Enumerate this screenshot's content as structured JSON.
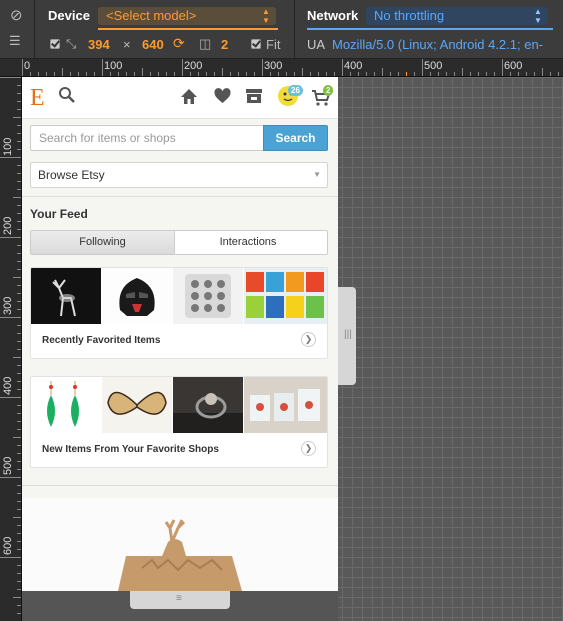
{
  "toolbar": {
    "device_label": "Device",
    "model_value": "<Select model>",
    "network_label": "Network",
    "network_value": "No throttling",
    "width_value": "394",
    "times": "×",
    "height_value": "640",
    "dpr_value": "2",
    "fit_label": "Fit",
    "ua_label": "UA",
    "ua_value": "Mozilla/5.0 (Linux; Android 4.2.1; en-",
    "accent_orange": "#ff9a2e",
    "accent_blue": "#58a8ff"
  },
  "ruler": {
    "top_labels": [
      "0",
      "100",
      "200",
      "300",
      "400",
      "500",
      "600"
    ],
    "left_labels": [
      "100",
      "200",
      "300",
      "400",
      "500",
      "600"
    ]
  },
  "page": {
    "logo": "E",
    "search_placeholder": "Search for items or shops",
    "search_button": "Search",
    "browse": "Browse Etsy",
    "feed_title": "Your Feed",
    "tabs": [
      "Following",
      "Interactions"
    ],
    "favorites_badge": "26",
    "cart_badge": "2",
    "cards": [
      {
        "label": "Recently Favorited Items"
      },
      {
        "label": "New Items From Your Favorite Shops"
      }
    ],
    "brand_color": "#e0711f",
    "search_color": "#4aa3d2"
  }
}
